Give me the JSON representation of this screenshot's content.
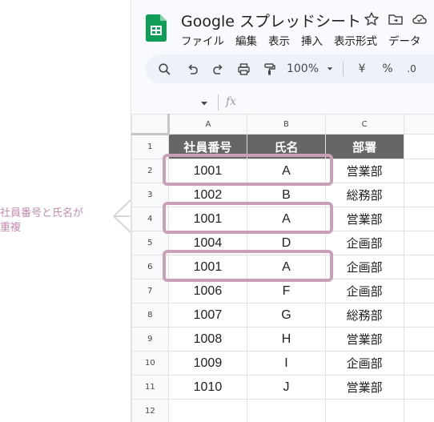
{
  "app": {
    "title": "Google スプレッドシート",
    "menu": [
      "ファイル",
      "編集",
      "表示",
      "挿入",
      "表示形式",
      "データ"
    ]
  },
  "toolbar": {
    "zoom": "100%",
    "currency": "¥",
    "percent": "%",
    "decimal": ".0"
  },
  "formula_bar": {
    "fx_label": "fx"
  },
  "sheet": {
    "columns": [
      "A",
      "B",
      "C"
    ],
    "rows": [
      "1",
      "2",
      "3",
      "4",
      "5",
      "6",
      "7",
      "8",
      "9",
      "10",
      "11",
      "12"
    ],
    "header": [
      "社員番号",
      "氏名",
      "部署"
    ],
    "data": [
      [
        "1001",
        "A",
        "営業部"
      ],
      [
        "1002",
        "B",
        "総務部"
      ],
      [
        "1001",
        "A",
        "営業部"
      ],
      [
        "1004",
        "D",
        "企画部"
      ],
      [
        "1001",
        "A",
        "企画部"
      ],
      [
        "1006",
        "F",
        "企画部"
      ],
      [
        "1007",
        "G",
        "総務部"
      ],
      [
        "1008",
        "H",
        "営業部"
      ],
      [
        "1009",
        "I",
        "企画部"
      ],
      [
        "1010",
        "J",
        "営業部"
      ]
    ]
  },
  "annotation": {
    "line1": "社員番号と氏名が",
    "line2": "重複",
    "color": "#c48bb0"
  },
  "colors": {
    "header_fill": "#666666",
    "highlight_border": "#c9a0b8",
    "sheets_green": "#0f9d58"
  }
}
